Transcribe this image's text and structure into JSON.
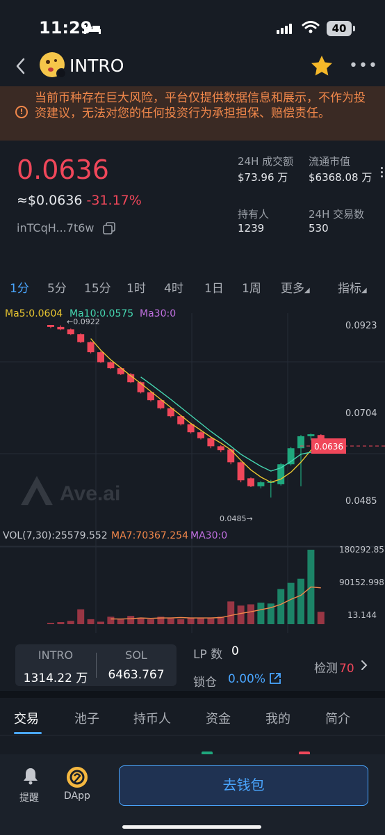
{
  "status_bar": {
    "time": "11:29",
    "battery": "40"
  },
  "header": {
    "title": "INTRO"
  },
  "warning": {
    "text": "当前币种存在巨大风险，平台仅提供数据信息和展示，不作为投资建议，无法对您的任何投资行为承担担保、赔偿责任。"
  },
  "price": {
    "value": "0.0636",
    "usd": "≈$0.0636",
    "change": "-31.17%",
    "address": "inTCqH...7t6w"
  },
  "stats": {
    "volume_label": "24H 成交额",
    "volume": "$73.96 万",
    "mcap_label": "流通市值",
    "mcap": "$6368.08 万",
    "holders_label": "持有人",
    "holders": "1239",
    "tx_label": "24H 交易数",
    "tx": "530"
  },
  "timeframes": [
    "1分",
    "5分",
    "15分",
    "1时",
    "4时",
    "1日",
    "1周"
  ],
  "more_label": "更多",
  "indicator_label": "指标",
  "chart_data": {
    "type": "candlestick",
    "ma_legend": {
      "ma5": "Ma5:0.0604",
      "ma10": "Ma10:0.0575",
      "ma30": "Ma30:0"
    },
    "y_ticks": [
      "0.0923",
      "0.0704",
      "0.0485"
    ],
    "high_label": "←0.0922",
    "low_label": "0.0485→",
    "current_price": "0.0636",
    "watermark": "Ave.ai",
    "candles": [
      [
        0.0923,
        0.0918,
        0.0923,
        0.0915
      ],
      [
        0.0918,
        0.0912,
        0.0922,
        0.091
      ],
      [
        0.0912,
        0.09,
        0.0914,
        0.0898
      ],
      [
        0.09,
        0.088,
        0.0902,
        0.0878
      ],
      [
        0.088,
        0.0855,
        0.0882,
        0.0852
      ],
      [
        0.0855,
        0.083,
        0.0858,
        0.0828
      ],
      [
        0.083,
        0.0815,
        0.0832,
        0.0813
      ],
      [
        0.0815,
        0.08,
        0.0818,
        0.0798
      ],
      [
        0.08,
        0.078,
        0.0803,
        0.0778
      ],
      [
        0.078,
        0.0755,
        0.0782,
        0.0752
      ],
      [
        0.0755,
        0.0735,
        0.0757,
        0.0732
      ],
      [
        0.0735,
        0.0715,
        0.0738,
        0.0712
      ],
      [
        0.0715,
        0.0695,
        0.0718,
        0.0692
      ],
      [
        0.0695,
        0.0675,
        0.0698,
        0.0672
      ],
      [
        0.0675,
        0.0655,
        0.0678,
        0.0652
      ],
      [
        0.0655,
        0.064,
        0.0658,
        0.0637
      ],
      [
        0.064,
        0.062,
        0.0642,
        0.0615
      ],
      [
        0.062,
        0.061,
        0.0623,
        0.0605
      ],
      [
        0.0612,
        0.058,
        0.0614,
        0.0575
      ],
      [
        0.058,
        0.0535,
        0.0582,
        0.053
      ],
      [
        0.054,
        0.052,
        0.0542,
        0.0518
      ],
      [
        0.052,
        0.053,
        0.0533,
        0.0515
      ],
      [
        0.053,
        0.0532,
        0.0536,
        0.0492
      ],
      [
        0.0525,
        0.0575,
        0.0578,
        0.0522
      ],
      [
        0.0575,
        0.0615,
        0.0618,
        0.0572
      ],
      [
        0.0615,
        0.0645,
        0.0648,
        0.052
      ],
      [
        0.0645,
        0.065,
        0.0652,
        0.0635
      ],
      [
        0.0648,
        0.0636,
        0.065,
        0.063
      ]
    ],
    "ma5": [
      null,
      null,
      null,
      null,
      0.0889,
      0.086,
      0.0836,
      0.0816,
      0.0796,
      0.0777,
      0.0757,
      0.0737,
      0.0717,
      0.0697,
      0.0677,
      0.066,
      0.0643,
      0.0628,
      0.0611,
      0.0585,
      0.0561,
      0.0543,
      0.053,
      0.0538,
      0.0555,
      0.058,
      0.061,
      0.063
    ],
    "ma10": [
      null,
      null,
      null,
      null,
      null,
      null,
      null,
      null,
      null,
      0.0793,
      0.0775,
      0.0756,
      0.0737,
      0.0717,
      0.0697,
      0.0677,
      0.0657,
      0.0639,
      0.062,
      0.06,
      0.0585,
      0.057,
      0.0558,
      0.0566,
      0.0582,
      0.06,
      0.0605,
      0.0606
    ],
    "volume_legend": {
      "vol": "VOL(7,30):25579.552",
      "ma7": "MA7:70367.254",
      "ma30": "MA30:0"
    },
    "volume_ticks": [
      "180292.851",
      "90152.998",
      "13.144"
    ],
    "volume": [
      3200,
      5000,
      8000,
      36000,
      12000,
      6000,
      18000,
      12000,
      20000,
      14000,
      12000,
      18000,
      14000,
      12000,
      16000,
      14000,
      14000,
      18000,
      55000,
      45000,
      48000,
      52000,
      50000,
      85000,
      100000,
      110000,
      180292,
      30000
    ],
    "volume_up": [
      false,
      false,
      false,
      false,
      false,
      false,
      false,
      false,
      false,
      false,
      false,
      false,
      false,
      false,
      false,
      false,
      false,
      false,
      false,
      false,
      false,
      true,
      true,
      true,
      true,
      true,
      true,
      false
    ],
    "vol_ma7": [
      null,
      null,
      null,
      null,
      null,
      null,
      12600,
      12400,
      13200,
      15000,
      14000,
      15000,
      15000,
      16000,
      15000,
      15000,
      15000,
      16000,
      21000,
      26000,
      30000,
      35000,
      40000,
      48000,
      60000,
      70000,
      90000,
      88000
    ]
  },
  "swap": {
    "token_a": "INTRO",
    "amount_a": "1314.22 万",
    "token_b": "SOL",
    "amount_b": "6463.767"
  },
  "lp": {
    "label": "LP 数",
    "value": "0"
  },
  "lock": {
    "label": "锁仓",
    "value": "0.00%"
  },
  "detect": {
    "label": "检测",
    "score": "70"
  },
  "tabs": [
    "交易",
    "池子",
    "持币人",
    "资金",
    "我的",
    "简介"
  ],
  "bottom": {
    "alert_label": "提醒",
    "dapp_label": "DApp",
    "wallet_button": "去钱包"
  },
  "colors": {
    "up": "#1fa77d",
    "down": "#f0475a",
    "accent": "#4aa6ff",
    "warning": "#f2884b",
    "ma5": "#e8c530",
    "ma10": "#45d6b0",
    "ma30": "#c070e0",
    "vol_ma7": "#f2884b"
  }
}
